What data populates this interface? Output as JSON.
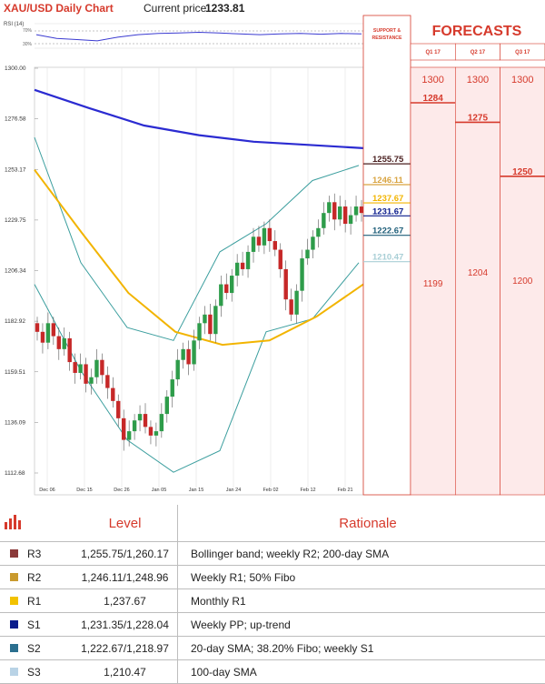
{
  "header": {
    "title": "XAU/USD Daily Chart",
    "price_label": "Current price",
    "price_value": "1233.81"
  },
  "rsi_label": "RSI (14)",
  "rsi_levels": [
    "70%",
    "30%"
  ],
  "sr_header": "SUPPORT & RESISTANCE",
  "forecast_title": "FORECASTS",
  "colors": {
    "candle_up": "#2e9c4a",
    "candle_down": "#c62828",
    "sma_200": "#2b2bd1",
    "sma_100_yellow": "#f2b400",
    "bollinger": "#3b9e9e",
    "forecast_red": "#d63a2c",
    "forecast_bg": "#fdeaea"
  },
  "chart_data": {
    "type": "candlestick",
    "y_ticks": [
      "1300.00",
      "1276.58",
      "1253.17",
      "1229.75",
      "1206.34",
      "1182.92",
      "1159.51",
      "1136.09",
      "1112.68"
    ],
    "ylim": [
      1112.68,
      1300.0
    ],
    "x_ticks": [
      "Dec 06",
      "Dec 15",
      "Dec 26",
      "Jan 05",
      "Jan 15",
      "Jan 24",
      "Feb 02",
      "Feb 12",
      "Feb 21"
    ],
    "candles_close": [
      1178,
      1173,
      1182,
      1176,
      1170,
      1175,
      1164,
      1159,
      1163,
      1154,
      1157,
      1165,
      1158,
      1152,
      1146,
      1138,
      1128,
      1132,
      1137,
      1140,
      1134,
      1130,
      1132,
      1140,
      1148,
      1156,
      1165,
      1170,
      1163,
      1174,
      1182,
      1186,
      1177,
      1190,
      1200,
      1196,
      1204,
      1210,
      1207,
      1215,
      1222,
      1218,
      1226,
      1220,
      1216,
      1207,
      1193,
      1186,
      1197,
      1212,
      1216,
      1222,
      1226,
      1233,
      1238,
      1230,
      1236,
      1228,
      1232,
      1236,
      1233
    ],
    "series": [
      {
        "label": "200-day SMA",
        "values": [
          1290,
          1281.5,
          1273.5,
          1269,
          1266,
          1264.5,
          1263
        ]
      },
      {
        "label": "100-day SMA",
        "values": [
          1253,
          1224,
          1196,
          1178,
          1172,
          1174,
          1185,
          1200
        ]
      },
      {
        "label": "Bollinger upper",
        "values": [
          1268,
          1210,
          1180,
          1174,
          1215,
          1228,
          1248,
          1255
        ]
      },
      {
        "label": "Bollinger lower",
        "values": [
          1200,
          1160,
          1128,
          1113,
          1123,
          1178,
          1184,
          1210
        ]
      }
    ],
    "rsi_values": [
      55,
      40,
      35,
      30,
      45,
      55,
      60,
      62,
      65,
      62,
      58,
      55,
      58,
      60,
      57,
      60,
      58
    ]
  },
  "sr_levels": [
    {
      "label": "1255.75",
      "value": 1255.75,
      "color": "#4a1f1f"
    },
    {
      "label": "1246.11",
      "value": 1246.11,
      "color": "#d9a441"
    },
    {
      "label": "1237.67",
      "value": 1237.67,
      "color": "#f2b400"
    },
    {
      "label": "1231.67",
      "value": 1231.67,
      "color": "#0a1c8c"
    },
    {
      "label": "1222.67",
      "value": 1222.67,
      "color": "#1f5f7a"
    },
    {
      "label": "1210.47",
      "value": 1210.47,
      "color": "#a9cfd6"
    }
  ],
  "forecasts": [
    {
      "quarter": "Q1 17",
      "high": "1300",
      "mid": "1284",
      "mid_value": 1284,
      "low": "1199"
    },
    {
      "quarter": "Q2 17",
      "high": "1300",
      "mid": "1275",
      "mid_value": 1275,
      "low": "1204"
    },
    {
      "quarter": "Q3 17",
      "high": "1300",
      "mid": "1250",
      "mid_value": 1250,
      "low": "1200"
    }
  ],
  "table": {
    "headers": [
      "Level",
      "Rationale"
    ],
    "rows": [
      {
        "name": "R3",
        "color": "#8b3a3a",
        "level": "1,255.75/1,260.17",
        "rationale": "Bollinger band; weekly R2; 200-day SMA"
      },
      {
        "name": "R2",
        "color": "#c99a2e",
        "level": "1,246.11/1,248.96",
        "rationale": "Weekly R1; 50% Fibo"
      },
      {
        "name": "R1",
        "color": "#f2c200",
        "level": "1,237.67",
        "rationale": "Monthly R1"
      },
      {
        "name": "S1",
        "color": "#0a1c8c",
        "level": "1,231.35/1,228.04",
        "rationale": "Weekly PP; up-trend"
      },
      {
        "name": "S2",
        "color": "#2b6f8f",
        "level": "1,222.67/1,218.97",
        "rationale": "20-day SMA; 38.20% Fibo; weekly S1"
      },
      {
        "name": "S3",
        "color": "#b9d3e6",
        "level": "1,210.47",
        "rationale": "100-day SMA"
      }
    ]
  }
}
